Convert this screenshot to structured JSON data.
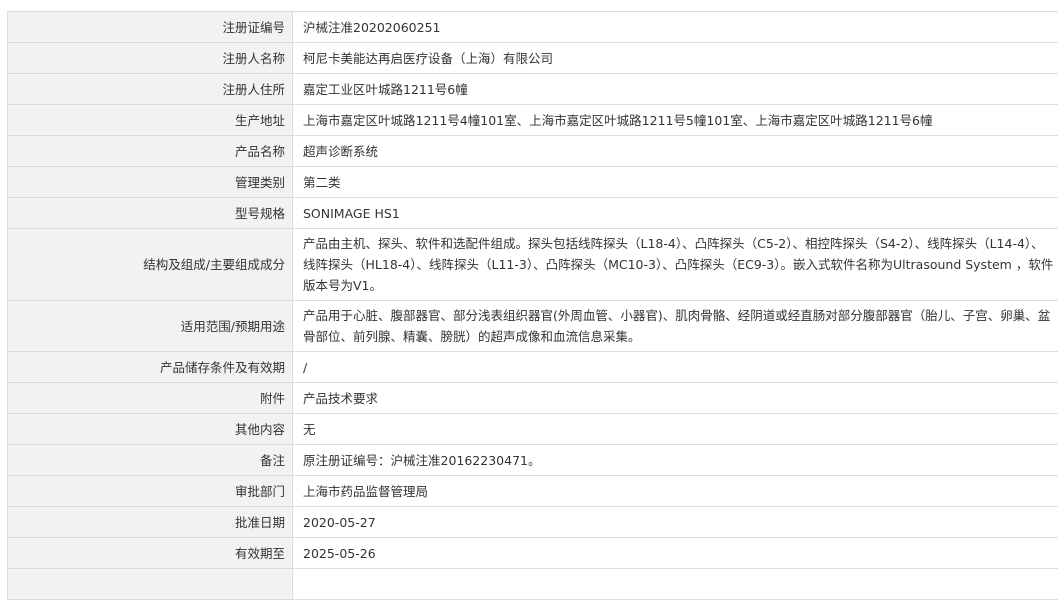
{
  "rows": [
    {
      "label": "注册证编号",
      "value": "沪械注准20202060251"
    },
    {
      "label": "注册人名称",
      "value": "柯尼卡美能达再启医疗设备（上海）有限公司"
    },
    {
      "label": "注册人住所",
      "value": "嘉定工业区叶城路1211号6幢"
    },
    {
      "label": "生产地址",
      "value": "上海市嘉定区叶城路1211号4幢101室、上海市嘉定区叶城路1211号5幢101室、上海市嘉定区叶城路1211号6幢"
    },
    {
      "label": "产品名称",
      "value": "超声诊断系统"
    },
    {
      "label": "管理类别",
      "value": "第二类"
    },
    {
      "label": "型号规格",
      "value": "SONIMAGE HS1"
    },
    {
      "label": "结构及组成/主要组成成分",
      "value": "产品由主机、探头、软件和选配件组成。探头包括线阵探头（L18-4）、凸阵探头（C5-2）、相控阵探头（S4-2）、线阵探头（L14-4）、线阵探头（HL18-4）、线阵探头（L11-3）、凸阵探头（MC10-3）、凸阵探头（EC9-3）。嵌入式软件名称为Ultrasound System ，软件版本号为V1。"
    },
    {
      "label": "适用范围/预期用途",
      "value": "产品用于心脏、腹部器官、部分浅表组织器官(外周血管、小器官)、肌肉骨骼、经阴道或经直肠对部分腹部器官（胎儿、子宫、卵巢、盆骨部位、前列腺、精囊、膀胱）的超声成像和血流信息采集。"
    },
    {
      "label": "产品储存条件及有效期",
      "value": "/"
    },
    {
      "label": "附件",
      "value": "产品技术要求"
    },
    {
      "label": "其他内容",
      "value": "无"
    },
    {
      "label": "备注",
      "value": "原注册证编号：沪械注准20162230471。"
    },
    {
      "label": "审批部门",
      "value": "上海市药品监督管理局"
    },
    {
      "label": "批准日期",
      "value": "2020-05-27"
    },
    {
      "label": "有效期至",
      "value": "2025-05-26"
    }
  ]
}
